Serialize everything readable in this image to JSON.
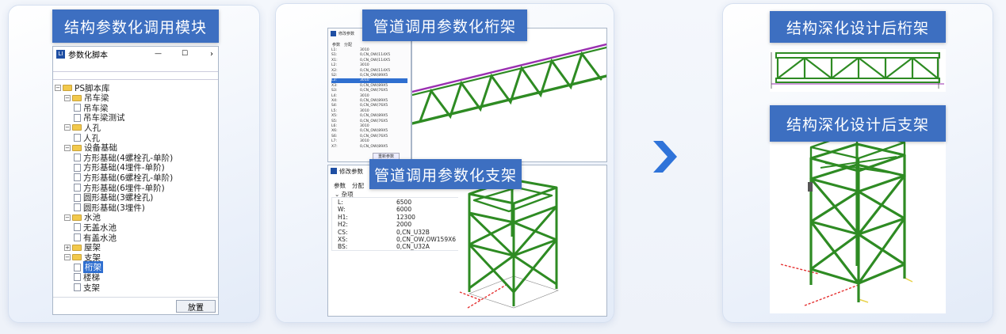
{
  "left_panel": {
    "banner": "结构参数化调用模块",
    "window_title": "参数化脚本",
    "window_controls": [
      "—",
      "☐",
      "›"
    ],
    "tree": [
      {
        "text": "PS脚本库",
        "level": 0,
        "kind": "folder",
        "toggle": "−"
      },
      {
        "text": "吊车梁",
        "level": 1,
        "kind": "folder",
        "toggle": "−"
      },
      {
        "text": "吊车梁",
        "level": 2,
        "kind": "doc"
      },
      {
        "text": "吊车梁测试",
        "level": 2,
        "kind": "doc"
      },
      {
        "text": "人孔",
        "level": 1,
        "kind": "folder",
        "toggle": "−"
      },
      {
        "text": "人孔",
        "level": 2,
        "kind": "doc"
      },
      {
        "text": "设备基础",
        "level": 1,
        "kind": "folder",
        "toggle": "−"
      },
      {
        "text": "方形基础(4螺栓孔-单阶)",
        "level": 2,
        "kind": "doc"
      },
      {
        "text": "方形基础(4埋件-单阶)",
        "level": 2,
        "kind": "doc"
      },
      {
        "text": "方形基础(6螺栓孔-单阶)",
        "level": 2,
        "kind": "doc"
      },
      {
        "text": "方形基础(6埋件-单阶)",
        "level": 2,
        "kind": "doc"
      },
      {
        "text": "圆形基础(3螺栓孔)",
        "level": 2,
        "kind": "doc"
      },
      {
        "text": "圆形基础(3埋件)",
        "level": 2,
        "kind": "doc"
      },
      {
        "text": "水池",
        "level": 1,
        "kind": "folder",
        "toggle": "−"
      },
      {
        "text": "无盖水池",
        "level": 2,
        "kind": "doc"
      },
      {
        "text": "有盖水池",
        "level": 2,
        "kind": "doc"
      },
      {
        "text": "屋架",
        "level": 1,
        "kind": "folder",
        "toggle": "+"
      },
      {
        "text": "支架",
        "level": 1,
        "kind": "folder",
        "toggle": "−"
      },
      {
        "text": "桁架",
        "level": 2,
        "kind": "doc",
        "selected": true
      },
      {
        "text": "楼梯",
        "level": 2,
        "kind": "doc"
      },
      {
        "text": "支架",
        "level": 2,
        "kind": "doc"
      }
    ],
    "place_button": "放置"
  },
  "middle_panel": {
    "truss_banner": "管道调用参数化桁架",
    "truss_window_title": "修改参数",
    "truss_tabs": [
      "参数",
      "分配"
    ],
    "truss_params": [
      [
        "L1:",
        "3010"
      ],
      [
        "S1:",
        "0,CN_OW(114X5"
      ],
      [
        "X1:",
        "0,CN_OW(114X5"
      ],
      [
        "L2:",
        "3010"
      ],
      [
        "X2:",
        "0,CN_OW(114X5"
      ],
      [
        "S2:",
        "0,CN_OW(89X5"
      ],
      [
        "L3:",
        "3010"
      ],
      [
        "X3:",
        "0,CN_OW(89X5"
      ],
      [
        "S3:",
        "0,CN_OW(76X5"
      ],
      [
        "L4:",
        "3010"
      ],
      [
        "X4:",
        "0,CN_OW(89X5"
      ],
      [
        "S4:",
        "0,CN_OW(76X5"
      ],
      [
        "L5:",
        "3010"
      ],
      [
        "X5:",
        "0,CN_OW(89X5"
      ],
      [
        "S5:",
        "0,CN_OW(76X5"
      ],
      [
        "L6:",
        "3010"
      ],
      [
        "X6:",
        "0,CN_OW(89X5"
      ],
      [
        "S6:",
        "0,CN_OW(76X5"
      ],
      [
        "L7:",
        "3010"
      ],
      [
        "X7:",
        "0,CN_OW(89X5"
      ]
    ],
    "truss_button": "重新参数",
    "support_banner": "管道调用参数化支架",
    "support_window_title": "修改参数",
    "support_tabs": [
      "参数",
      "分配"
    ],
    "support_group": "杂项",
    "support_params": [
      [
        "L:",
        "6500"
      ],
      [
        "W:",
        "6000"
      ],
      [
        "H1:",
        "12300"
      ],
      [
        "H2:",
        "2000"
      ],
      [
        "CS:",
        "0,CN_U32B"
      ],
      [
        "XS:",
        "0,CN_OW,OW159X6"
      ],
      [
        "BS:",
        "0,CN_U32A"
      ]
    ]
  },
  "right_panel": {
    "truss_banner": "结构深化设计后桁架",
    "support_banner": "结构深化设计后支架"
  },
  "colors": {
    "banner": "#3d6fc1",
    "arrow": "#2f73d9",
    "steel_green": "#2e8b23",
    "truss_chord": "#9a2fb0"
  }
}
